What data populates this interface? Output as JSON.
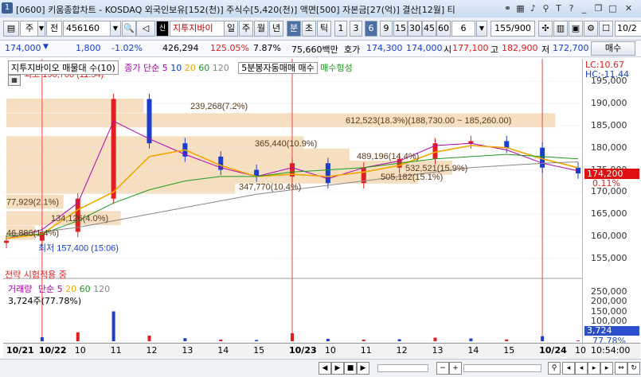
{
  "window": {
    "title": "[0600] 키움종합차트 - KOSDAQ 외국인보유[152(천)] 주식수[5,420(천)] 액면[500] 자본금[27(억)] 결산[12월] 티",
    "app_badge": "1"
  },
  "toolbar": {
    "market_select": "주",
    "type_select": "전",
    "code_value": "456160",
    "stock_name": "지투지바이",
    "periods": [
      "일",
      "주",
      "월",
      "년",
      "분",
      "초",
      "틱"
    ],
    "active_period": "분",
    "intervals": [
      "1",
      "3",
      "6",
      "9",
      "15",
      "30",
      "45",
      "60"
    ],
    "active_interval": "6",
    "interval_select": "6",
    "count_display": "155/900",
    "right_input": "10/2"
  },
  "quote": {
    "price": "174,000",
    "change": "1,800",
    "change_pct": "-1.02%",
    "volume": "426,294",
    "volume_ratio": "125.05%",
    "turnover_pct": "7.87%",
    "trade_value": "75,660백만",
    "hoga_label": "호가",
    "ask": "174,300",
    "bid": "174,000",
    "open_label": "시",
    "open": "177,100",
    "high_label": "고",
    "high": "182,900",
    "low_label": "저",
    "low": "172,700",
    "buy_button": "매수"
  },
  "legend": {
    "title": "지투지바이오 매물대 수(10)",
    "ma_label": "종가 단순",
    "ma_periods": [
      "5",
      "10",
      "20",
      "60",
      "120"
    ],
    "signal_name": "5분봉자동매매 매수",
    "signal_label": "매수형성",
    "strategy_mode": "전략 시험적용 중"
  },
  "price_panel": {
    "max_label": "최고 196,700 (11:54)",
    "min_label": "최저 157,400 (15:06)",
    "lc_label": "LC:10.67",
    "hc_label": "HC:-11.44",
    "current_price": "174,200",
    "current_pct": "0.11%",
    "y_ticks": [
      "195,000",
      "190,000",
      "185,000",
      "180,000",
      "175,000",
      "170,000",
      "165,000",
      "160,000",
      "155,000"
    ],
    "volume_profile_labels": [
      "239,268(7.2%)",
      "612,523(18.3%)(188,730.00 ~ 185,260.00)",
      "365,440(10.9%)",
      "489,196(14.4%)",
      "532,521(15.9%)",
      "505,182(15.1%)",
      "347,770(10.4%)",
      "77,929(2.1%)",
      "134,126(4.0%)",
      "46,886(1.4%)"
    ]
  },
  "volume_panel": {
    "legend_title": "거래량",
    "ma_label": "단순",
    "ma_periods": [
      "5",
      "20",
      "60",
      "120"
    ],
    "value_label": "3,724주(77.78%)",
    "y_ticks": [
      "250,000",
      "200,000",
      "150,000",
      "100,000",
      "50,000"
    ],
    "current_value": "3,724",
    "current_pct": "77.78%"
  },
  "x_axis": {
    "labels": [
      "10/21",
      "10/22",
      "10",
      "11",
      "12",
      "13",
      "14",
      "15",
      "10/23",
      "10",
      "11",
      "12",
      "13",
      "14",
      "15",
      "10/24",
      "10"
    ],
    "time": "10:54:00"
  },
  "colors": {
    "up": "#e02020",
    "down": "#1a3fd0",
    "ma5": "#b000b0",
    "ma20": "#f2a600",
    "ma60": "#1e9a1e",
    "ma120": "#888888",
    "profile": "#f5dfc0",
    "price_box": "#e01010",
    "volume_box": "#2a4fc8"
  },
  "chart_data": {
    "type": "line",
    "x": [
      "10/21",
      "10/22",
      "10/22 10",
      "10/22 11",
      "10/22 12",
      "10/22 13",
      "10/22 14",
      "10/22 15",
      "10/23",
      "10/23 10",
      "10/23 11",
      "10/23 12",
      "10/23 13",
      "10/23 14",
      "10/23 15",
      "10/24",
      "10/24 10"
    ],
    "series": [
      {
        "name": "종가",
        "values": [
          159000,
          161000,
          168500,
          191000,
          181000,
          178000,
          175000,
          173500,
          176500,
          172000,
          175500,
          177500,
          181000,
          181500,
          180000,
          175500,
          174200
        ]
      },
      {
        "name": "5",
        "values": [
          159500,
          161500,
          167500,
          186000,
          182000,
          178500,
          175500,
          173500,
          175500,
          173000,
          175500,
          177000,
          180500,
          181000,
          179500,
          176500,
          174800
        ]
      },
      {
        "name": "20",
        "values": [
          159500,
          160500,
          166000,
          170000,
          178000,
          179500,
          176000,
          173500,
          174000,
          173500,
          174500,
          176000,
          179000,
          180500,
          180000,
          177500,
          175500
        ]
      },
      {
        "name": "60",
        "values": [
          160000,
          160500,
          163500,
          167500,
          170500,
          172500,
          173500,
          173500,
          174500,
          175000,
          175500,
          176500,
          177500,
          178000,
          178500,
          178000,
          177500
        ]
      },
      {
        "name": "120",
        "values": [
          160500,
          161000,
          162000,
          163500,
          165000,
          166500,
          168000,
          169500,
          170500,
          171500,
          172500,
          173500,
          174500,
          175500,
          176000,
          176500,
          176800
        ]
      }
    ],
    "volume": [
      500,
      20000,
      45000,
      150000,
      28000,
      15000,
      8000,
      6000,
      40000,
      12000,
      8000,
      10000,
      18000,
      14000,
      9000,
      25000,
      3724
    ],
    "ylim": [
      153000,
      199000
    ],
    "volume_ylim": [
      0,
      280000
    ],
    "events": [
      "10/22",
      "10/23",
      "10/24"
    ]
  }
}
